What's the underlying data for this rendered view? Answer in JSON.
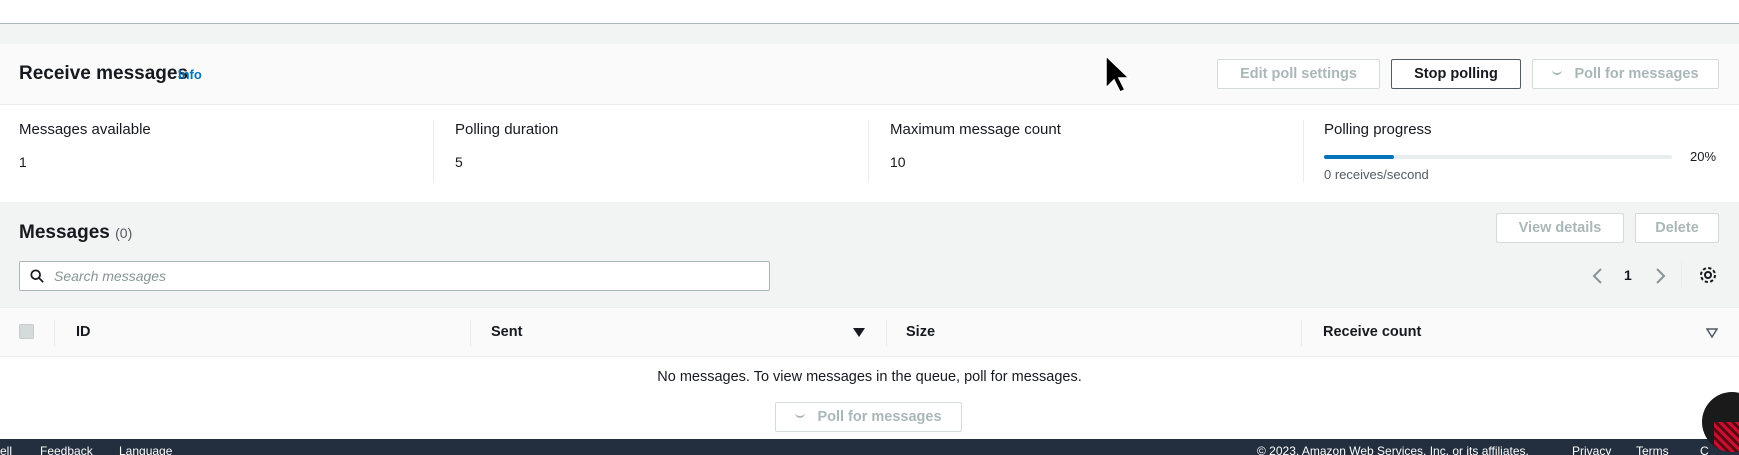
{
  "receive": {
    "title": "Receive messages",
    "info": "Info",
    "edit_poll_settings": "Edit poll settings",
    "stop_polling": "Stop polling",
    "poll_for_messages": "Poll for messages"
  },
  "stats": {
    "messages_available_label": "Messages available",
    "messages_available_value": "1",
    "polling_duration_label": "Polling duration",
    "polling_duration_value": "5",
    "max_message_count_label": "Maximum message count",
    "max_message_count_value": "10",
    "polling_progress_label": "Polling progress",
    "polling_progress_percent": "20%",
    "polling_progress_fraction": 0.2,
    "receives_per_second": "0 receives/second"
  },
  "messages": {
    "title": "Messages",
    "count": "(0)",
    "view_details": "View details",
    "delete": "Delete",
    "search_placeholder": "Search messages",
    "page": "1"
  },
  "table": {
    "columns": [
      "ID",
      "Sent",
      "Size",
      "Receive count"
    ],
    "empty_text": "No messages. To view messages in the queue, poll for messages.",
    "poll_for_messages": "Poll for messages"
  },
  "footer": {
    "left_items": [
      "ell",
      "Feedback",
      "Language"
    ],
    "copyright": "© 2023, Amazon Web Services, Inc. or its affiliates.",
    "privacy": "Privacy",
    "terms": "Terms",
    "cookie": "C"
  },
  "colors": {
    "accent": "#0073bb",
    "footer_bg": "#232f3e",
    "disabled_text": "#aab7b8"
  },
  "icons": {
    "search": "search-icon",
    "prev": "chevron-left-icon",
    "next": "chevron-right-icon",
    "settings": "gear-icon",
    "sort": "caret-down-icon"
  }
}
